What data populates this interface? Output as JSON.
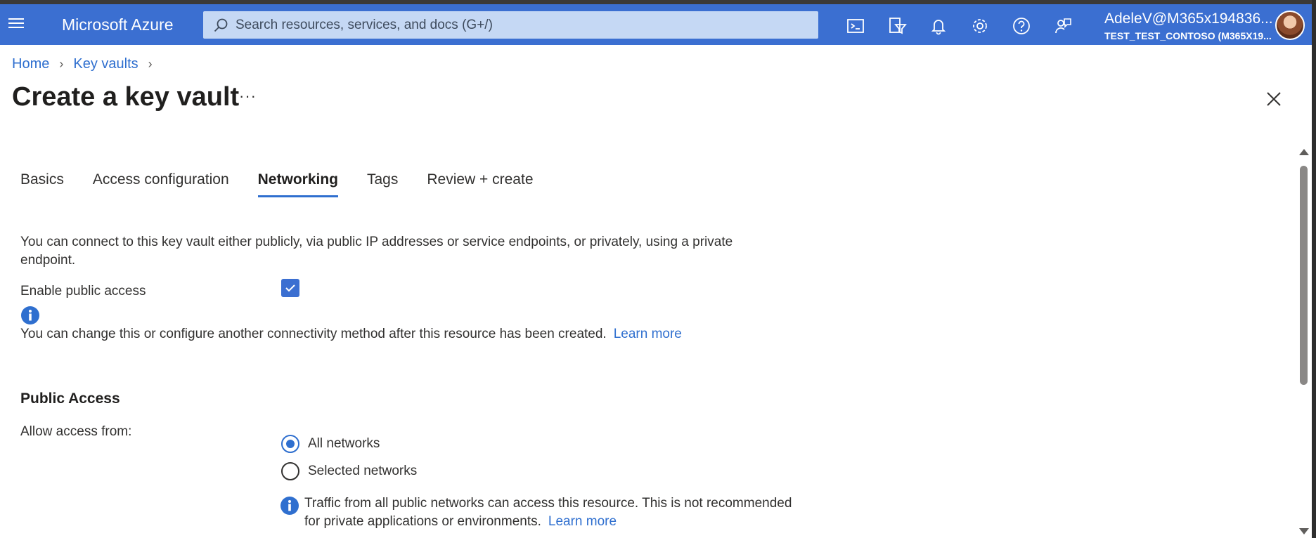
{
  "topbar": {
    "brand": "Microsoft Azure",
    "search_placeholder": "Search resources, services, and docs (G+/)",
    "icons": [
      "cloud-shell-icon",
      "directory-filter-icon",
      "notifications-icon",
      "settings-icon",
      "help-icon",
      "feedback-icon"
    ],
    "account_user": "AdeleV@M365x194836...",
    "account_tenant": "TEST_TEST_CONTOSO (M365X19..."
  },
  "breadcrumb": {
    "home": "Home",
    "key_vaults": "Key vaults"
  },
  "page": {
    "title": "Create a key vault",
    "more": "···"
  },
  "tabs": [
    {
      "label": "Basics",
      "active": false
    },
    {
      "label": "Access configuration",
      "active": false
    },
    {
      "label": "Networking",
      "active": true
    },
    {
      "label": "Tags",
      "active": false
    },
    {
      "label": "Review + create",
      "active": false
    }
  ],
  "networking": {
    "description": "You can connect to this key vault either publicly, via public IP addresses or service endpoints, or privately, using a private endpoint.",
    "enable_public_access_label": "Enable public access",
    "enable_public_access_checked": true,
    "info_note": "You can change this or configure another connectivity method after this resource has been created.",
    "learn_more": "Learn more",
    "public_access_heading": "Public Access",
    "allow_access_label": "Allow access from:",
    "options": [
      {
        "label": "All networks",
        "selected": true
      },
      {
        "label": "Selected networks",
        "selected": false
      }
    ],
    "warning": "Traffic from all public networks can access this resource. This is not recommended for private applications or environments."
  },
  "colors": {
    "accent": "#3b6fd1",
    "link": "#2f6fcf",
    "text": "#323130"
  }
}
